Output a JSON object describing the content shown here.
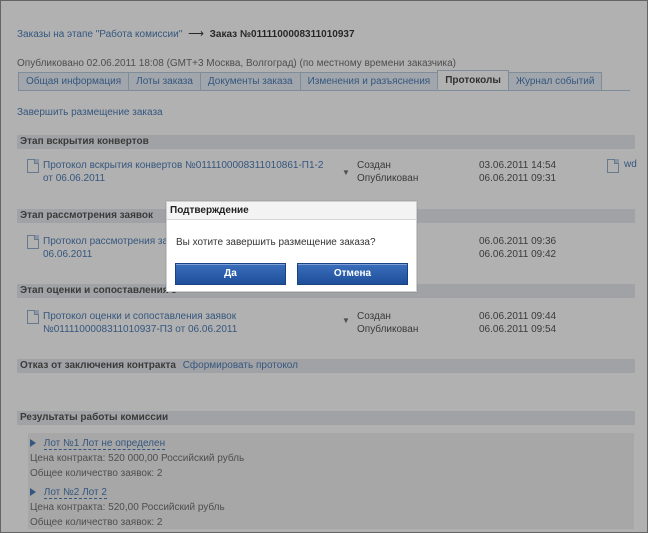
{
  "breadcrumb": {
    "parent": "Заказы на этапе \"Работа комиссии\"",
    "separator": "⟶",
    "current": "Заказ №0111100008311010937"
  },
  "published": "Опубликовано 02.06.2011 18:08 (GMT+3 Москва, Волгоград) (по местному времени заказчика)",
  "tabs": [
    {
      "label": "Общая информация"
    },
    {
      "label": "Лоты заказа"
    },
    {
      "label": "Документы заказа"
    },
    {
      "label": "Изменения и разъяснения"
    },
    {
      "label": "Протоколы",
      "active": true
    },
    {
      "label": "Журнал событий"
    }
  ],
  "finish_link": "Завершить размещение заказа",
  "stages": {
    "opening": {
      "header": "Этап вскрытия конвертов",
      "protocol_line1": "Протокол вскрытия конвертов №0111100008311010861-П1-2",
      "protocol_line2": "от 06.06.2011",
      "status1": "Создан",
      "date1": "03.06.2011 14:54",
      "status2": "Опубликован",
      "date2": "06.06.2011 09:31",
      "attachment": "wd"
    },
    "review": {
      "header": "Этап рассмотрения заявок",
      "protocol_line1": "Протокол рассмотрения заяв",
      "protocol_line2": "06.06.2011",
      "date1": "06.06.2011 09:36",
      "date2": "06.06.2011 09:42"
    },
    "evaluation": {
      "header": "Этап оценки и сопоставления з",
      "protocol_line1": "Протокол оценки и сопоставления заявок",
      "protocol_line2": "№0111100008311010937-П3 от 06.06.2011",
      "status1": "Создан",
      "date1": "06.06.2011 09:44",
      "status2": "Опубликован",
      "date2": "06.06.2011 09:54"
    },
    "refusal": {
      "header": "Отказ от заключения контракта",
      "action": "Сформировать протокол"
    },
    "results": {
      "header": "Результаты работы комиссии",
      "lots": [
        {
          "title": "Лот №1 Лот не определен",
          "price": "Цена контракта: 520 000,00 Российский рубль",
          "count": "Общее количество заявок: 2"
        },
        {
          "title": "Лот №2 Лот 2",
          "price": "Цена контракта: 520,00 Российский рубль",
          "count": "Общее количество заявок: 2"
        }
      ]
    }
  },
  "dialog": {
    "title": "Подтверждение",
    "message": "Вы хотите завершить размещение заказа?",
    "ok": "Да",
    "cancel": "Отмена"
  },
  "colors": {
    "link": "#2a63a8",
    "button": "#2a5ca8",
    "overlay": "#464646"
  }
}
